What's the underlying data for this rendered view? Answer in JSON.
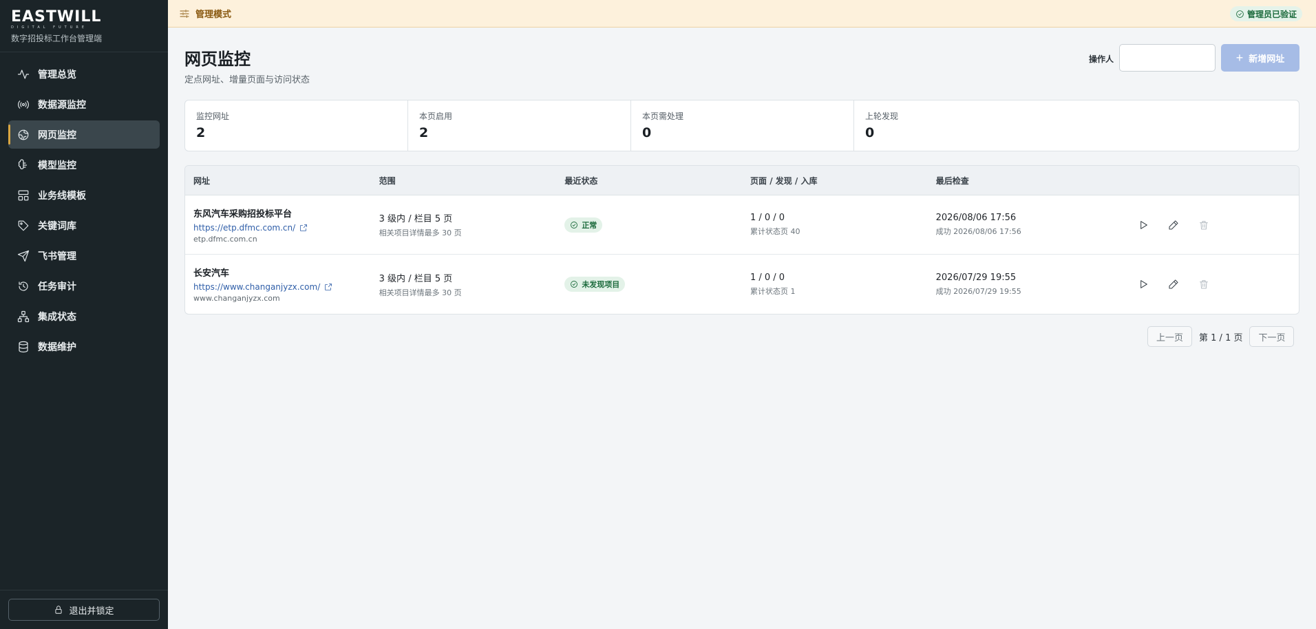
{
  "sidebar": {
    "logo": "EASTWILL",
    "logo_sub": "DIGITAL FUTURE",
    "tagline": "数字招投标工作台管理端",
    "items": [
      {
        "label": "管理总览",
        "icon": "activity-icon"
      },
      {
        "label": "数据源监控",
        "icon": "radio-icon"
      },
      {
        "label": "网页监控",
        "icon": "globe-icon"
      },
      {
        "label": "模型监控",
        "icon": "brain-icon"
      },
      {
        "label": "业务线模板",
        "icon": "layout-icon"
      },
      {
        "label": "关键词库",
        "icon": "tag-icon"
      },
      {
        "label": "飞书管理",
        "icon": "send-icon"
      },
      {
        "label": "任务审计",
        "icon": "history-icon"
      },
      {
        "label": "集成状态",
        "icon": "network-icon"
      },
      {
        "label": "数据维护",
        "icon": "database-icon"
      }
    ],
    "active_index": 2,
    "logout_label": "退出并锁定"
  },
  "banner": {
    "mode_label": "管理模式",
    "verified_label": "管理员已验证"
  },
  "page": {
    "title": "网页监控",
    "subtitle": "定点网址、增量页面与访问状态",
    "operator_label": "操作人",
    "operator_value": "",
    "add_label": "新增网址"
  },
  "stats": [
    {
      "label": "监控网址",
      "value": "2"
    },
    {
      "label": "本页启用",
      "value": "2"
    },
    {
      "label": "本页需处理",
      "value": "0"
    },
    {
      "label": "上轮发现",
      "value": "0"
    }
  ],
  "table": {
    "headers": [
      "网址",
      "范围",
      "最近状态",
      "页面 / 发现 / 入库",
      "最后检查",
      ""
    ],
    "rows": [
      {
        "name": "东风汽车采购招投标平台",
        "url": "https://etp.dfmc.com.cn/",
        "domain": "etp.dfmc.com.cn",
        "scope": "3 级内 / 栏目 5 页",
        "scope_sub": "相关项目详情最多 30 页",
        "status": "正常",
        "counts": "1 / 0 / 0",
        "counts_sub": "累计状态页 40",
        "last_check": "2026/08/06 17:56",
        "last_check_sub": "成功 2026/08/06 17:56"
      },
      {
        "name": "长安汽车",
        "url": "https://www.changanjyzx.com/",
        "domain": "www.changanjyzx.com",
        "scope": "3 级内 / 栏目 5 页",
        "scope_sub": "相关项目详情最多 30 页",
        "status": "未发现项目",
        "counts": "1 / 0 / 0",
        "counts_sub": "累计状态页 1",
        "last_check": "2026/07/29 19:55",
        "last_check_sub": "成功 2026/07/29 19:55"
      }
    ]
  },
  "pager": {
    "prev": "上一页",
    "info": "第 1 / 1 页",
    "next": "下一页"
  }
}
